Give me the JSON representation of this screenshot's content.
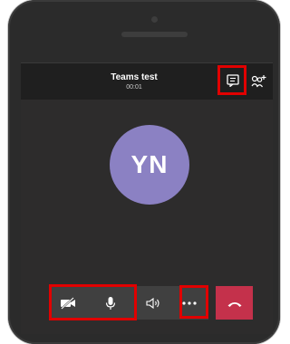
{
  "call": {
    "title": "Teams test",
    "duration": "00:01"
  },
  "participant": {
    "initials": "YN",
    "avatar_color": "#8b81c3"
  },
  "controls": [
    {
      "icon": "video-off-icon"
    },
    {
      "icon": "microphone-icon"
    },
    {
      "icon": "speaker-icon"
    },
    {
      "icon": "more-options-icon"
    },
    {
      "icon": "hang-up-icon"
    }
  ],
  "header_icons": [
    "chat-icon",
    "add-people-icon"
  ],
  "colors": {
    "background": "#2d2c2c",
    "header": "#1f1f1f",
    "hangup": "#c4314b",
    "highlight": "#e10000"
  }
}
